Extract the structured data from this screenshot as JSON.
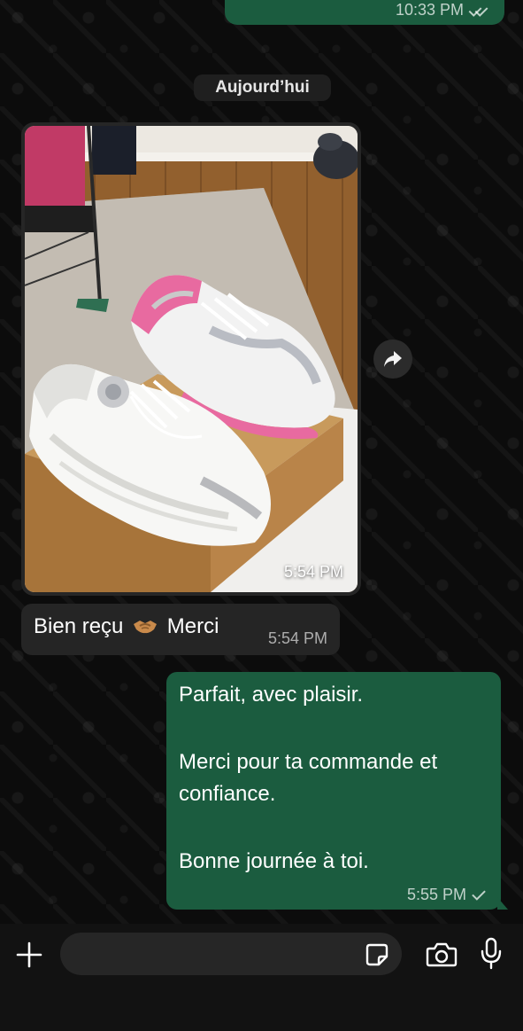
{
  "colors": {
    "background": "#0c0c0c",
    "outgoing_bubble": "#1b5c3f",
    "incoming_bubble": "#252525",
    "date_chip": "#1f1f1f",
    "composer_bg": "#121212"
  },
  "top_message": {
    "time": "10:33 PM",
    "status_icon": "double-check-icon"
  },
  "date_separator": "Aujourd’hui",
  "image_message": {
    "description_icon": "photo",
    "time": "5:54 PM"
  },
  "forward_icon": "share-arrow-icon",
  "incoming_message": {
    "text_before": "Bien reçu",
    "emoji": "handshake-icon",
    "text_after": "Merci",
    "time": "5:54 PM"
  },
  "outgoing_message": {
    "lines": [
      "Parfait, avec plaisir.",
      "",
      "Merci pour ta commande et",
      "confiance.",
      "",
      "Bonne journée à toi."
    ],
    "time": "5:55 PM",
    "status_icon": "check-icon"
  },
  "composer": {
    "placeholder": "",
    "icons": [
      "plus-icon",
      "sticker-icon",
      "camera-icon",
      "microphone-icon"
    ]
  }
}
